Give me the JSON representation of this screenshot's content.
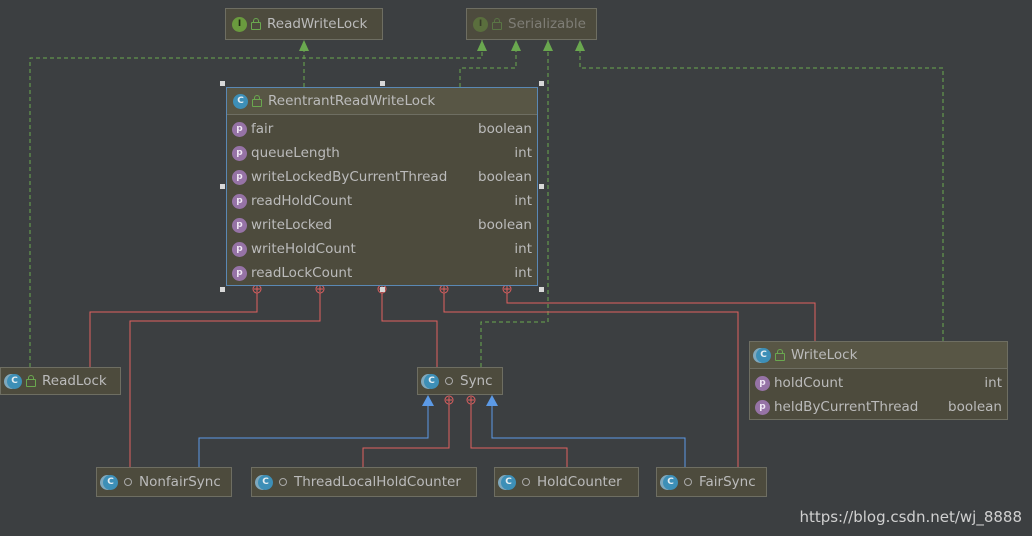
{
  "colors": {
    "background": "#3c3f41",
    "node_fill": "#4d4b3d",
    "node_header": "#585645",
    "node_border": "#6e6e62",
    "selection_border": "#5a88b4",
    "realization_edge": "#6aa84f",
    "inner_class_edge": "#e06060",
    "inheritance_edge": "#5c9ae6",
    "class_icon": "#3d8fb7",
    "interface_icon": "#6a9a3e",
    "property_icon": "#9673a6"
  },
  "nodes": {
    "read_write_lock": {
      "title": "ReadWriteLock",
      "icon": "interface-icon"
    },
    "serializable": {
      "title": "Serializable",
      "icon": "interface-icon"
    },
    "reentrant_read_write_lock": {
      "title": "ReentrantReadWriteLock",
      "icon": "class-icon",
      "properties": [
        {
          "name": "fair",
          "type": "boolean"
        },
        {
          "name": "queueLength",
          "type": "int"
        },
        {
          "name": "writeLockedByCurrentThread",
          "type": "boolean"
        },
        {
          "name": "readHoldCount",
          "type": "int"
        },
        {
          "name": "writeLocked",
          "type": "boolean"
        },
        {
          "name": "writeHoldCount",
          "type": "int"
        },
        {
          "name": "readLockCount",
          "type": "int"
        }
      ]
    },
    "read_lock": {
      "title": "ReadLock",
      "icon": "class-icon"
    },
    "sync": {
      "title": "Sync",
      "icon": "class-icon"
    },
    "write_lock": {
      "title": "WriteLock",
      "icon": "class-icon",
      "properties": [
        {
          "name": "holdCount",
          "type": "int"
        },
        {
          "name": "heldByCurrentThread",
          "type": "boolean"
        }
      ]
    },
    "nonfair_sync": {
      "title": "NonfairSync",
      "icon": "class-icon"
    },
    "thread_local_hold_counter": {
      "title": "ThreadLocalHoldCounter",
      "icon": "class-icon"
    },
    "hold_counter": {
      "title": "HoldCounter",
      "icon": "class-icon"
    },
    "fair_sync": {
      "title": "FairSync",
      "icon": "class-icon"
    }
  },
  "watermark": "https://blog.csdn.net/wj_8888"
}
